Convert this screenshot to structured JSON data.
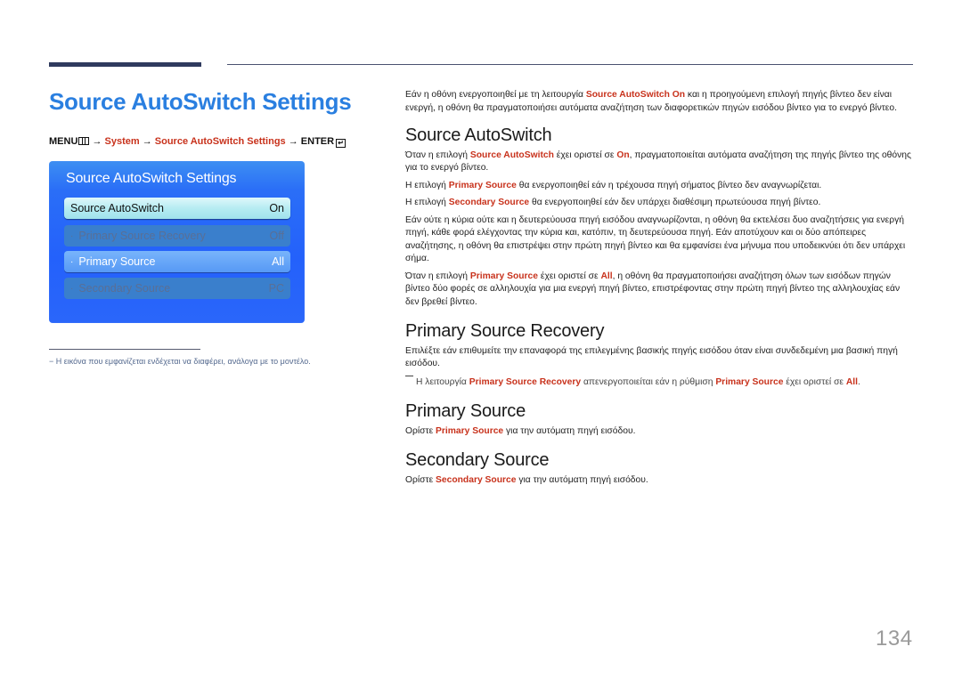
{
  "page_title": "Source AutoSwitch Settings",
  "menu_path": {
    "menu": "MENU",
    "arrow": "→",
    "system": "System",
    "settings": "Source AutoSwitch Settings",
    "enter": "ENTER",
    "enter_glyph": "↵"
  },
  "osd": {
    "title": "Source AutoSwitch Settings",
    "items": [
      {
        "label": "Source AutoSwitch",
        "value": "On",
        "state": "selected"
      },
      {
        "label": "Primary Source Recovery",
        "value": "Off",
        "state": "disabled"
      },
      {
        "label": "Primary Source",
        "value": "All",
        "state": "active"
      },
      {
        "label": "Secondary Source",
        "value": "PC",
        "state": "disabled"
      }
    ],
    "bullet": "·"
  },
  "footnote": "− Η εικόνα που εμφανίζεται ενδέχεται να διαφέρει, ανάλογα με το μοντέλο.",
  "intro": {
    "t1": "Εάν η οθόνη ενεργοποιηθεί με τη λειτουργία ",
    "h1": "Source AutoSwitch On",
    "t2": " και η προηγούμενη επιλογή πηγής βίντεο δεν είναι ενεργή, η οθόνη θα πραγματοποιήσει αυτόματα αναζήτηση των διαφορετικών πηγών εισόδου βίντεο για το ενεργό βίντεο."
  },
  "sections": {
    "autoswitch": {
      "heading": "Source AutoSwitch",
      "p1": {
        "t1": "Όταν η επιλογή ",
        "h1": "Source AutoSwitch",
        "t2": " έχει οριστεί σε ",
        "h2": "On",
        "t3": ", πραγματοποιείται αυτόματα αναζήτηση της πηγής βίντεο της οθόνης για το ενεργό βίντεο."
      },
      "p2": {
        "t1": "Η επιλογή ",
        "h1": "Primary Source",
        "t2": " θα ενεργοποιηθεί εάν η τρέχουσα πηγή σήματος βίντεο δεν αναγνωρίζεται."
      },
      "p3": {
        "t1": "Η επιλογή ",
        "h1": "Secondary Source",
        "t2": " θα ενεργοποιηθεί εάν δεν υπάρχει διαθέσιμη πρωτεύουσα πηγή βίντεο."
      },
      "p4": "Εάν ούτε η κύρια ούτε και η δευτερεύουσα πηγή εισόδου αναγνωρίζονται, η οθόνη θα εκτελέσει δυο αναζητήσεις για ενεργή πηγή, κάθε φορά ελέγχοντας την κύρια και, κατόπιν, τη δευτερεύουσα πηγή. Εάν αποτύχουν και οι δύο απόπειρες αναζήτησης, η οθόνη θα επιστρέψει στην πρώτη πηγή βίντεο και θα εμφανίσει ένα μήνυμα που υποδεικνύει ότι δεν υπάρχει σήμα.",
      "p5": {
        "t1": "Όταν η επιλογή ",
        "h1": "Primary Source",
        "t2": " έχει οριστεί σε ",
        "h2": "All",
        "t3": ", η οθόνη θα πραγματοποιήσει αναζήτηση όλων των εισόδων πηγών βίντεο δύο φορές σε αλληλουχία για μια ενεργή πηγή βίντεο, επιστρέφοντας στην πρώτη πηγή βίντεο της αλληλουχίας εάν δεν βρεθεί βίντεο."
      }
    },
    "recovery": {
      "heading": "Primary Source Recovery",
      "p1": "Επιλέξτε εάν επιθυμείτε την επαναφορά της επιλεγμένης βασικής πηγής εισόδου όταν είναι συνδεδεμένη μια βασική πηγή εισόδου.",
      "note": {
        "t1": "Η λειτουργία ",
        "h1": "Primary Source Recovery",
        "t2": " απενεργοποιείται εάν η ρύθμιση ",
        "h2": "Primary Source",
        "t3": " έχει οριστεί σε ",
        "h3": "All",
        "t4": "."
      }
    },
    "primary": {
      "heading": "Primary Source",
      "p1": {
        "t1": "Ορίστε ",
        "h1": "Primary Source",
        "t2": " για την αυτόματη πηγή εισόδου."
      }
    },
    "secondary": {
      "heading": "Secondary Source",
      "p1": {
        "t1": "Ορίστε ",
        "h1": "Secondary Source",
        "t2": " για την αυτόματη πηγή εισόδου."
      }
    }
  },
  "page_number": "134",
  "colors": {
    "title_blue": "#2a7fe0",
    "highlight_red": "#c8321c",
    "osd_blue": "#2461fb"
  }
}
